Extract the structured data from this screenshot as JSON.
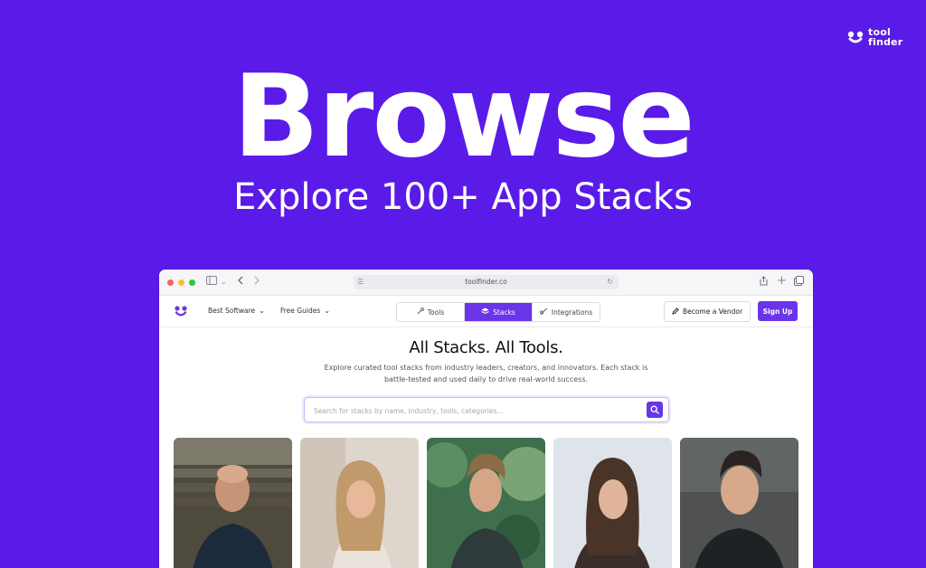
{
  "brand": {
    "line1": "tool",
    "line2": "finder"
  },
  "hero": {
    "title": "Browse",
    "subtitle": "Explore 100+ App Stacks"
  },
  "browser": {
    "url": "toolfinder.co"
  },
  "nav": {
    "links": [
      "Best Software",
      "Free Guides"
    ],
    "tabs": [
      {
        "label": "Tools",
        "icon": "wrench-icon",
        "active": false
      },
      {
        "label": "Stacks",
        "icon": "layers-icon",
        "active": true
      },
      {
        "label": "Integrations",
        "icon": "link-icon",
        "active": false
      }
    ],
    "vendor_label": "Become a Vendor",
    "signup_label": "Sign Up"
  },
  "content": {
    "title": "All Stacks. All Tools.",
    "description_line1": "Explore curated tool stacks from industry leaders, creators, and innovators. Each stack is",
    "description_line2": "battle-tested and used daily to drive real-world success.",
    "search_placeholder": "Search for stacks by name, industry, tools, categories..."
  },
  "colors": {
    "brand_purple": "#5a1be8",
    "accent": "#6a35e8"
  },
  "cards": [
    {
      "icon": "person-photo"
    },
    {
      "icon": "person-photo"
    },
    {
      "icon": "person-photo"
    },
    {
      "icon": "person-photo"
    },
    {
      "icon": "person-photo"
    }
  ]
}
